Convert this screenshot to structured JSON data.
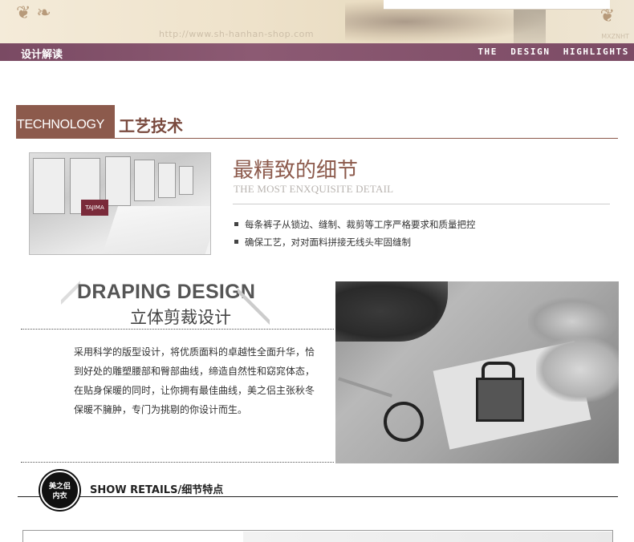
{
  "header": {
    "watermark": "http://www.sh-hanhan-shop.com",
    "watermark_code": "MXZNHT",
    "section_label_cn": "设计解读",
    "section_label_en": "THE DESIGN HIGHLIGHTS"
  },
  "technology": {
    "tag_en": "TECHNOLOGY",
    "title_cn": "工艺技术",
    "machine_logo": "TAJIMA",
    "detail_title": "最精致的细节",
    "detail_subtitle": "THE MOST ENXQUISITE DETAIL",
    "bullets": [
      "每条裤子从锁边、缝制、裁剪等工序严格要求和质量把控",
      "确保工艺，对对面料拼接无线头牢固缝制"
    ]
  },
  "draping": {
    "title_en": "DRAPING DESIGN",
    "title_cn": "立体剪裁设计",
    "paragraph": "采用科学的版型设计，将优质面料的卓越性全面升华，恰到好处的雕塑腰部和臀部曲线，缔造自然性和窈窕体态，在贴身保暖的同时，让你拥有最佳曲线，美之侣主张秋冬保暖不臃肿，专门为挑剔的你设计而生。"
  },
  "details": {
    "badge_line1": "美之侣",
    "badge_line2": "内衣",
    "title": "SHOW RETAILS/细节特点"
  },
  "colors": {
    "bar": "#7a4a63",
    "accent_brown": "#8c5a4c"
  },
  "icons": [
    "left-ornament-icon",
    "right-ornament-icon",
    "bullet-square-icon"
  ]
}
